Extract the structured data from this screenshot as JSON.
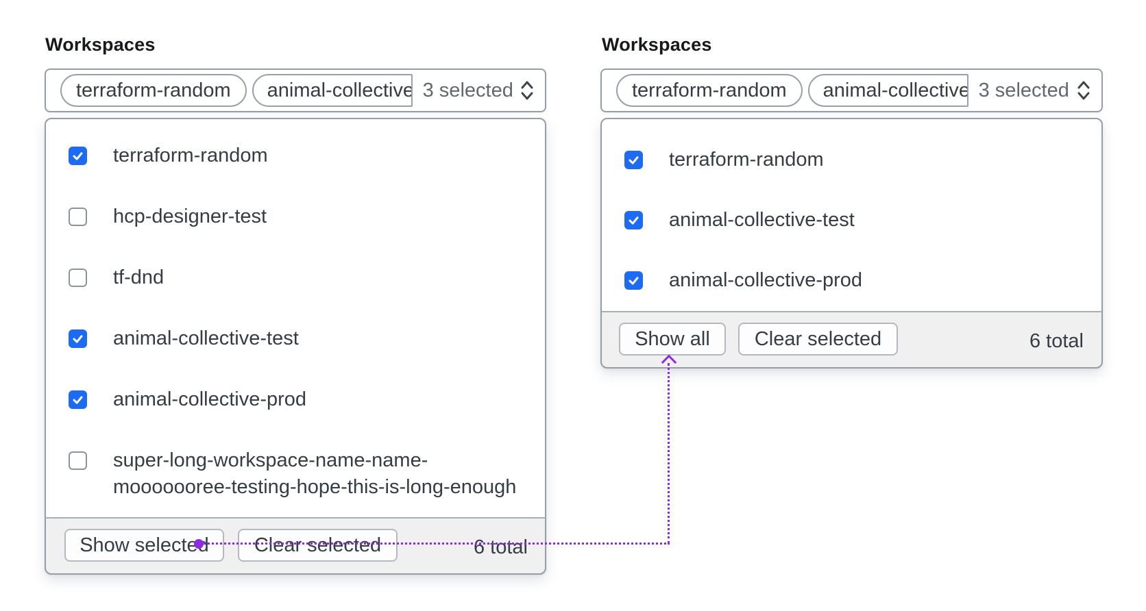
{
  "colors": {
    "checkbox_checked": "#1c6bf2",
    "connector_purple": "#8e2be2",
    "text_primary": "#363c44",
    "text_muted": "#62686f",
    "footer_bg": "#f0f0f1"
  },
  "left_panel": {
    "label": "Workspaces",
    "trigger": {
      "tags": [
        "terraform-random",
        "animal-collective"
      ],
      "count_label": "3 selected",
      "chevron_icon": "chevron-up-down"
    },
    "options": [
      {
        "label": "terraform-random",
        "checked": true
      },
      {
        "label": "hcp-designer-test",
        "checked": false
      },
      {
        "label": "tf-dnd",
        "checked": false
      },
      {
        "label": "animal-collective-test",
        "checked": true
      },
      {
        "label": "animal-collective-prod",
        "checked": true
      },
      {
        "label": "super-long-workspace-name-name-mooooooree-testing-hope-this-is-long-enough",
        "checked": false
      }
    ],
    "footer": {
      "show_button": "Show selected",
      "clear_button": "Clear selected",
      "total": "6 total"
    }
  },
  "right_panel": {
    "label": "Workspaces",
    "trigger": {
      "tags": [
        "terraform-random",
        "animal-collective"
      ],
      "count_label": "3 selected",
      "chevron_icon": "chevron-up-down"
    },
    "options": [
      {
        "label": "terraform-random",
        "checked": true
      },
      {
        "label": "animal-collective-test",
        "checked": true
      },
      {
        "label": "animal-collective-prod",
        "checked": true
      }
    ],
    "footer": {
      "show_button": "Show all",
      "clear_button": "Clear selected",
      "total": "6 total"
    }
  }
}
